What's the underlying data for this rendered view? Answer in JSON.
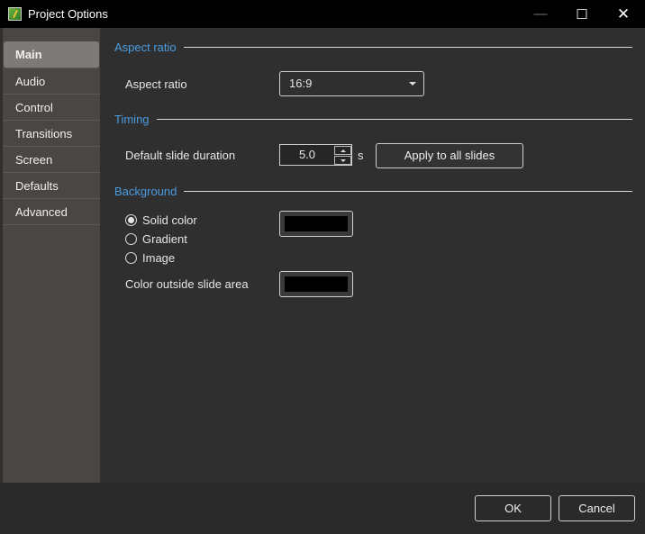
{
  "window": {
    "title": "Project Options",
    "minimize_icon": "minimize-icon",
    "maximize_icon": "maximize-icon",
    "close_icon": "close-icon"
  },
  "sidebar": {
    "items": [
      {
        "label": "Main",
        "active": true
      },
      {
        "label": "Audio"
      },
      {
        "label": "Control"
      },
      {
        "label": "Transitions"
      },
      {
        "label": "Screen"
      },
      {
        "label": "Defaults"
      },
      {
        "label": "Advanced"
      }
    ]
  },
  "aspect": {
    "section": "Aspect ratio",
    "label": "Aspect ratio",
    "value": "16:9"
  },
  "timing": {
    "section": "Timing",
    "label": "Default slide duration",
    "value": "5.0",
    "unit": "s",
    "apply": "Apply to all slides"
  },
  "background": {
    "section": "Background",
    "options": [
      {
        "label": "Solid color",
        "selected": true
      },
      {
        "label": "Gradient",
        "selected": false
      },
      {
        "label": "Image",
        "selected": false
      }
    ],
    "solid_color": "#000000",
    "outside_label": "Color outside slide area",
    "outside_color": "#000000"
  },
  "footer": {
    "ok": "OK",
    "cancel": "Cancel"
  },
  "colors": {
    "accent": "#4a9be0",
    "sidebar": "#4a4643",
    "content": "#2f2f2f"
  }
}
